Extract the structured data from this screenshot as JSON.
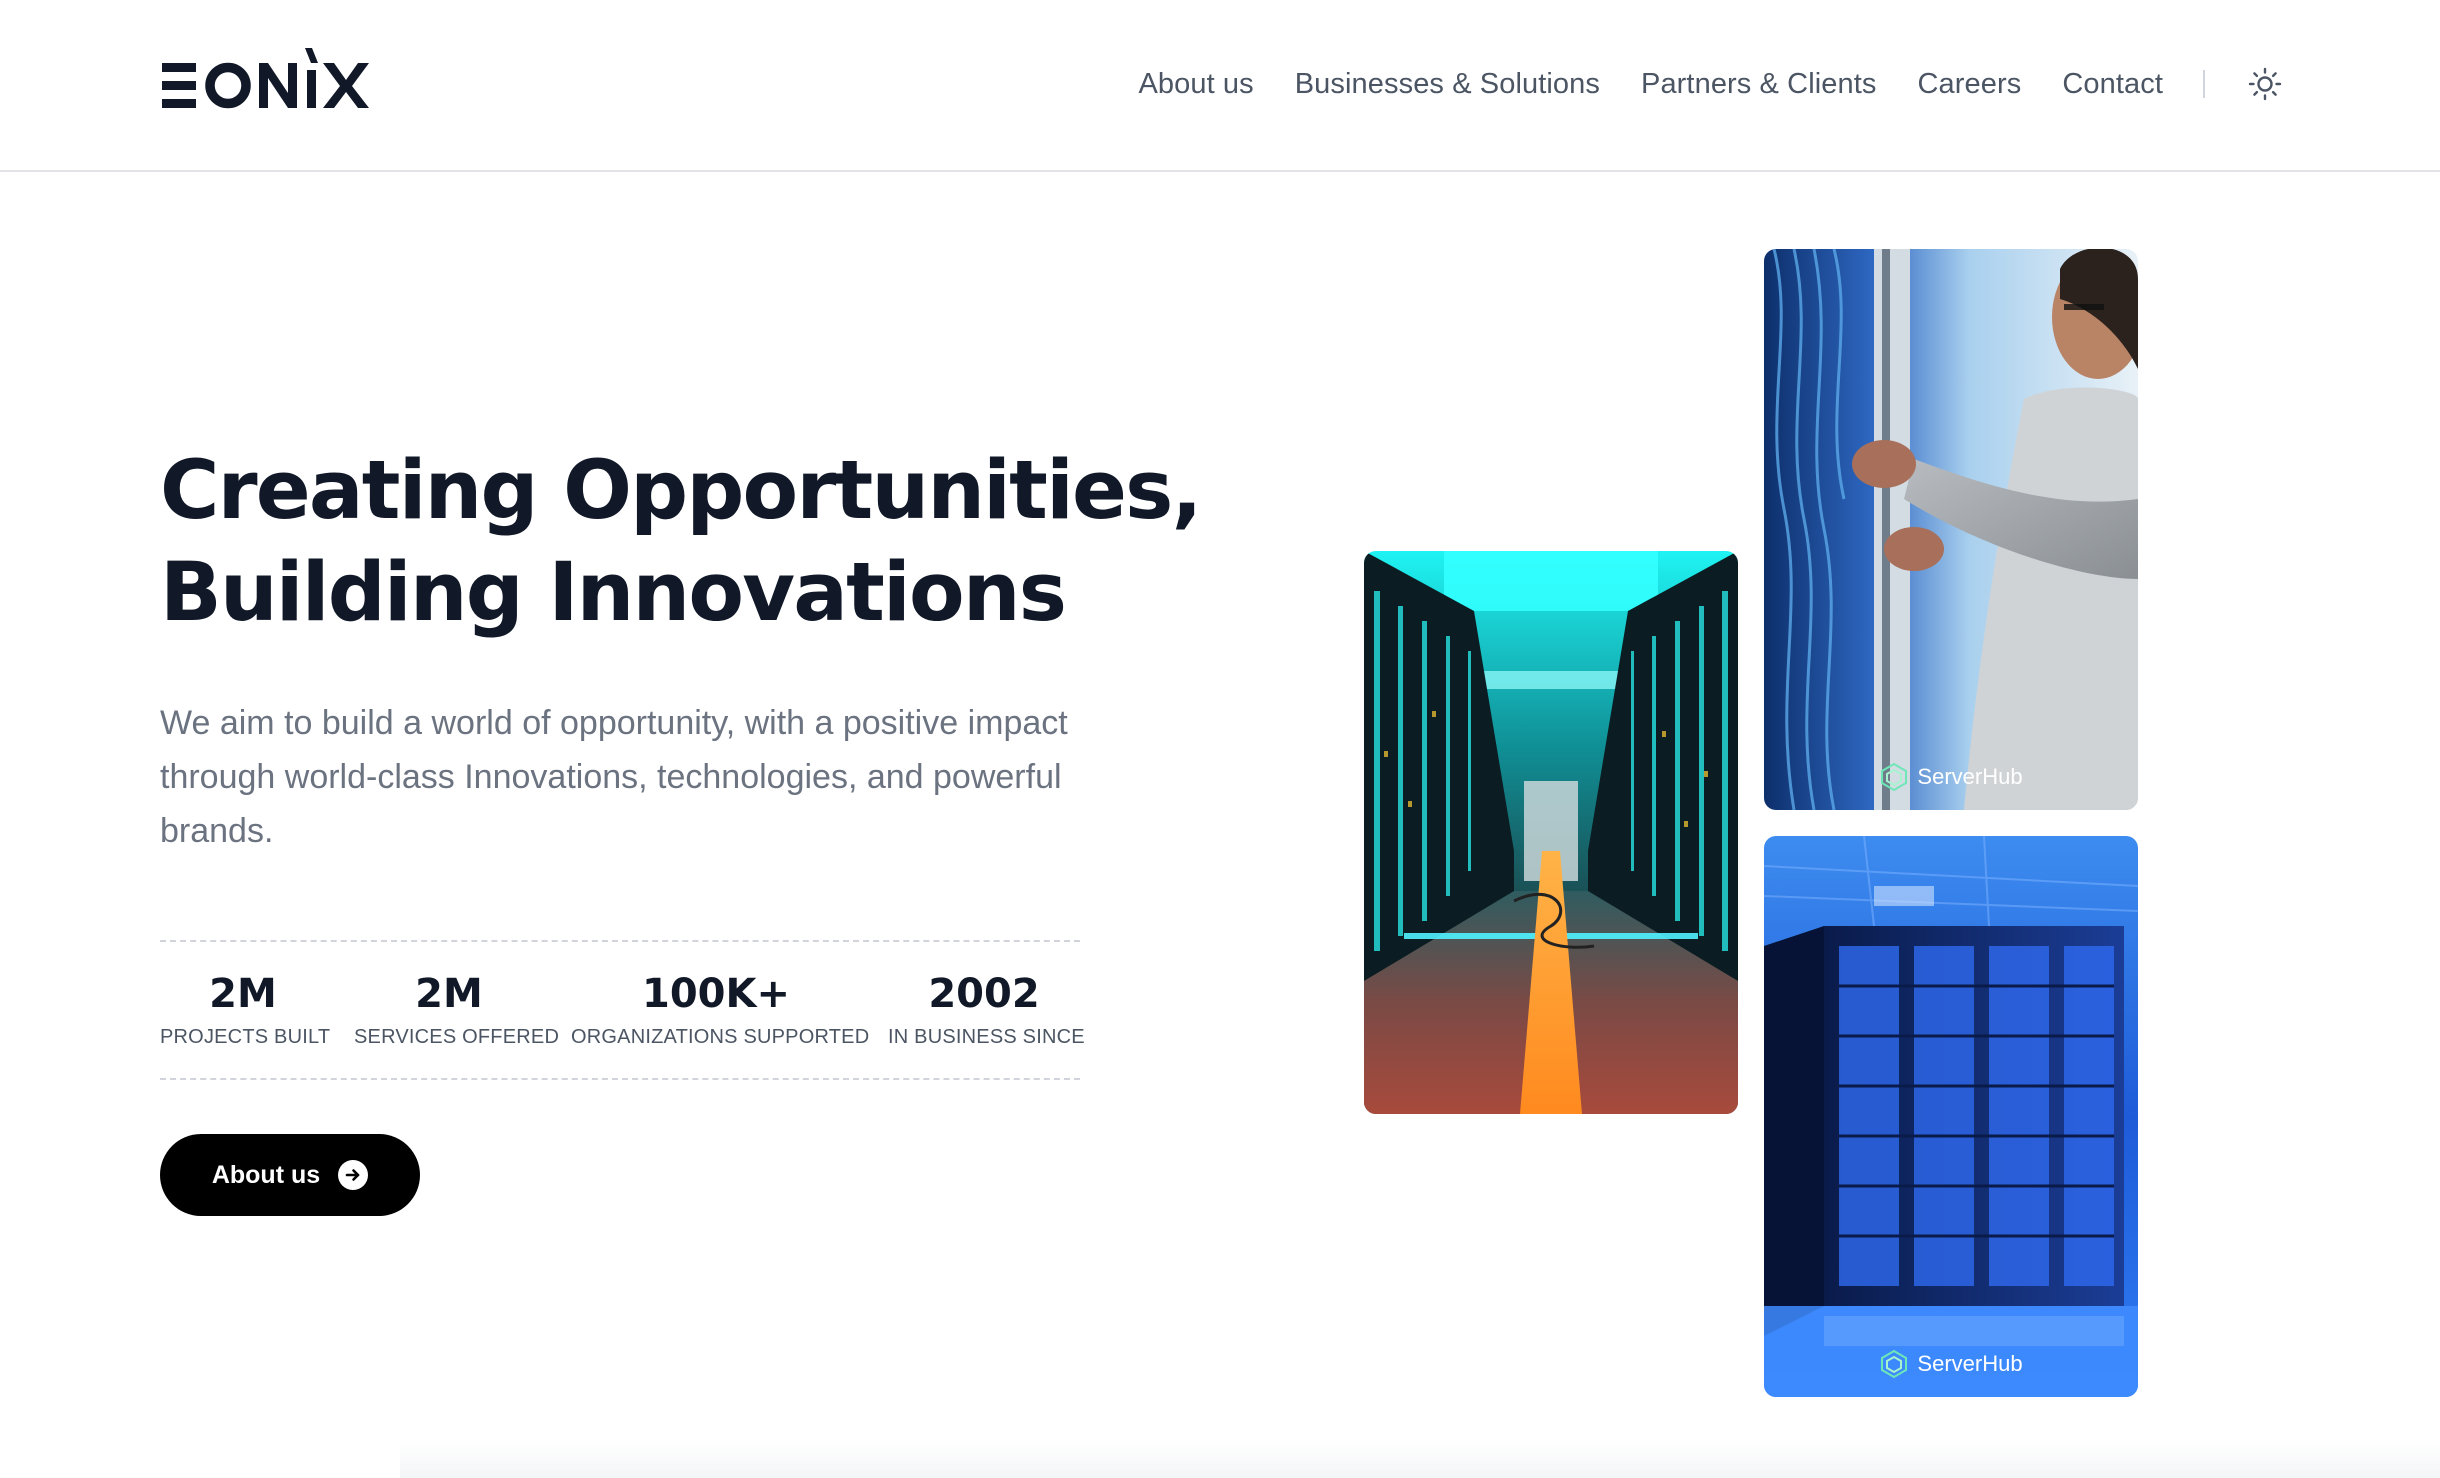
{
  "brand": {
    "name": "EONIX"
  },
  "nav": {
    "items": [
      "About us",
      "Businesses & Solutions",
      "Partners & Clients",
      "Careers",
      "Contact"
    ],
    "theme_icon": "sun-icon"
  },
  "hero": {
    "title_line1": "Creating Opportunities,",
    "title_line2": "Building Innovations",
    "description": "We aim to build a world of opportunity, with a positive impact through world-class Innovations, technologies, and powerful brands.",
    "stats": [
      {
        "value": "2M",
        "label": "PROJECTS BUILT"
      },
      {
        "value": "2M",
        "label": "SERVICES OFFERED"
      },
      {
        "value": "100K+",
        "label": "ORGANIZATIONS SUPPORTED"
      },
      {
        "value": "2002",
        "label": "IN BUSINESS SINCE"
      }
    ],
    "cta_label": "About us",
    "cta_icon": "arrow-right-circle-icon"
  },
  "images": {
    "watermark": "ServerHub"
  },
  "colors": {
    "text_dark": "#111827",
    "text_muted": "#6b7280",
    "nav_text": "#4b5563",
    "button_bg": "#000000",
    "border": "#e1e3e7"
  }
}
